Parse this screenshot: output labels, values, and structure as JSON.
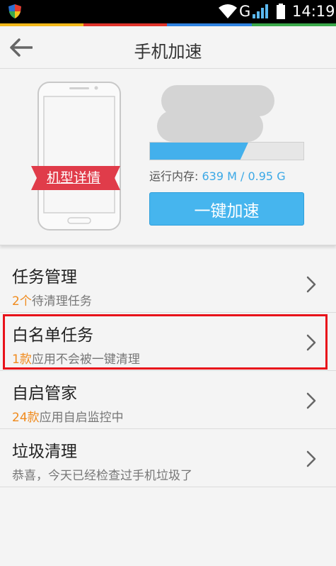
{
  "status_bar": {
    "network_type": "G",
    "time": "14:19"
  },
  "colors": {
    "accent_blue": "#46b5ee",
    "count_orange": "#f08a1c",
    "highlight_red": "#e8121a",
    "ribbon_red": "#e03c4a"
  },
  "header": {
    "title": "手机加速",
    "back_icon": "arrow-left-icon"
  },
  "device_card": {
    "model_details_label": "机型详情",
    "memory_label": "运行内存: ",
    "memory_value": "639 M / 0.95 G",
    "memory_used_fraction": 0.64,
    "boost_button_label": "一键加速"
  },
  "list": {
    "items": [
      {
        "title": "任务管理",
        "count": "2个",
        "subtitle": "待清理任务"
      },
      {
        "title": "白名单任务",
        "count": "1款",
        "subtitle": "应用不会被一键清理"
      },
      {
        "title": "自启管家",
        "count": "24款",
        "subtitle": "应用自启监控中"
      },
      {
        "title": "垃圾清理",
        "count": "",
        "subtitle": "恭喜，今天已经检查过手机垃圾了"
      }
    ]
  }
}
